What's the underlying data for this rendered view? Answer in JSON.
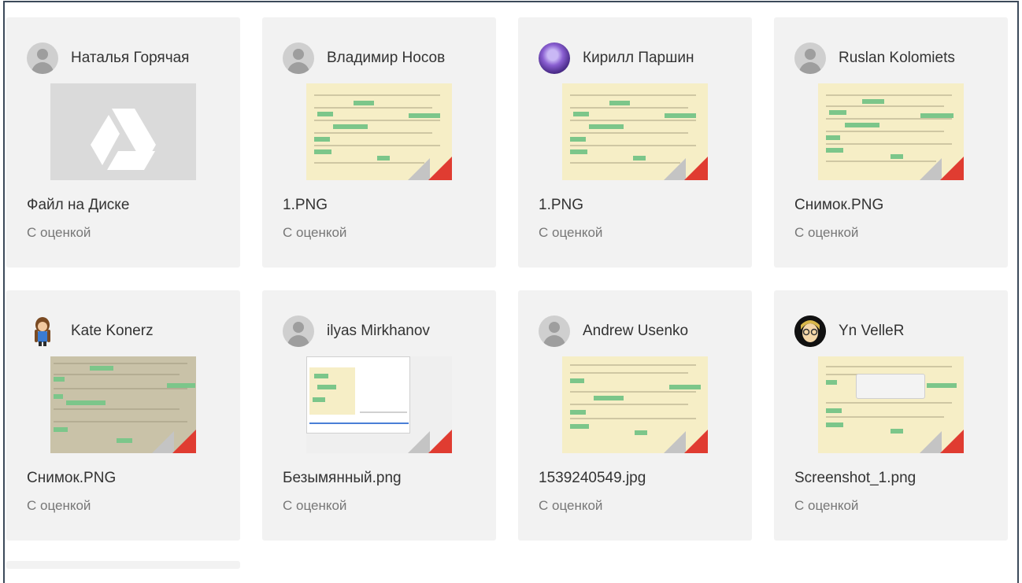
{
  "submissions": [
    {
      "author": "Наталья Горячая",
      "avatar": "person-icon",
      "thumb": "drive",
      "file": "Файл на Диске",
      "status": "С оценкой"
    },
    {
      "author": "Владимир Носов",
      "avatar": "person-icon",
      "thumb": "paper",
      "file": "1.PNG",
      "status": "С оценкой"
    },
    {
      "author": "Кирилл Паршин",
      "avatar": "purple-photo",
      "thumb": "paper",
      "file": "1.PNG",
      "status": "С оценкой"
    },
    {
      "author": "Ruslan Kolomiets",
      "avatar": "person-icon",
      "thumb": "paper",
      "file": "Снимок.PNG",
      "status": "С оценкой"
    },
    {
      "author": "Kate Konerz",
      "avatar": "kate-photo",
      "thumb": "paper-dark",
      "file": "Снимок.PNG",
      "status": "С оценкой"
    },
    {
      "author": "ilyas Mirkhanov",
      "avatar": "person-icon",
      "thumb": "paper-gray",
      "file": "Безымянный.png",
      "status": "С оценкой"
    },
    {
      "author": "Andrew Usenko",
      "avatar": "person-icon",
      "thumb": "paper",
      "file": "1539240549.jpg",
      "status": "С оценкой"
    },
    {
      "author": "Yn VelleR",
      "avatar": "yn-photo",
      "thumb": "paper",
      "file": "Screenshot_1.png",
      "status": "С оценкой"
    }
  ],
  "colors": {
    "card_bg": "#f2f2f2",
    "corner_red": "#e03c31",
    "tag_green": "#7cc68a"
  }
}
